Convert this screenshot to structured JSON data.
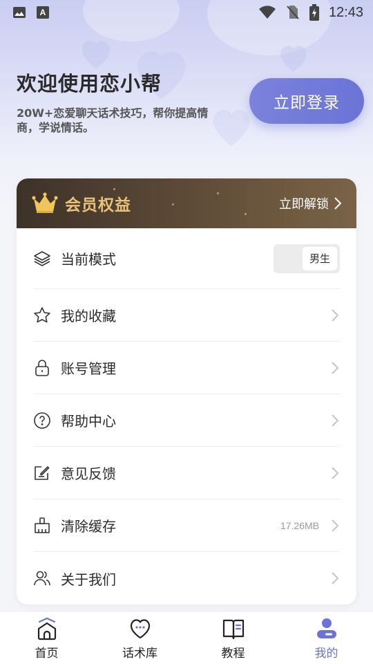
{
  "status_bar": {
    "time": "12:43",
    "left_icons": [
      "gallery-icon",
      "font-a-icon"
    ],
    "right_icons": [
      "wifi-icon",
      "no-sim-icon",
      "battery-charging-icon"
    ]
  },
  "header": {
    "title": "欢迎使用恋小帮",
    "subtitle": "20W+恋爱聊天话术技巧，帮你提高情商，学说情话。",
    "login_button": "立即登录"
  },
  "vip": {
    "title": "会员权益",
    "action": "立即解锁",
    "icon": "crown-icon",
    "title_color": "#e8c27a"
  },
  "menu": {
    "mode": {
      "label": "当前模式",
      "value": "男生",
      "icon": "layers-icon"
    },
    "items": [
      {
        "label": "我的收藏",
        "icon": "star-icon",
        "extra": ""
      },
      {
        "label": "账号管理",
        "icon": "lock-icon",
        "extra": ""
      },
      {
        "label": "帮助中心",
        "icon": "help-circle-icon",
        "extra": ""
      },
      {
        "label": "意见反馈",
        "icon": "feedback-edit-icon",
        "extra": ""
      },
      {
        "label": "清除缓存",
        "icon": "broom-icon",
        "extra": "17.26MB"
      },
      {
        "label": "关于我们",
        "icon": "users-icon",
        "extra": ""
      }
    ]
  },
  "tabbar": {
    "tabs": [
      {
        "label": "首页",
        "icon": "home-icon",
        "active": false
      },
      {
        "label": "话术库",
        "icon": "heart-chat-icon",
        "active": false
      },
      {
        "label": "教程",
        "icon": "book-icon",
        "active": false
      },
      {
        "label": "我的",
        "icon": "profile-icon",
        "active": true
      }
    ],
    "active_color": "#6b74d6"
  },
  "colors": {
    "accent": "#6b74d6",
    "vip_gold": "#e8c27a",
    "vip_bg": "#5a4835"
  }
}
